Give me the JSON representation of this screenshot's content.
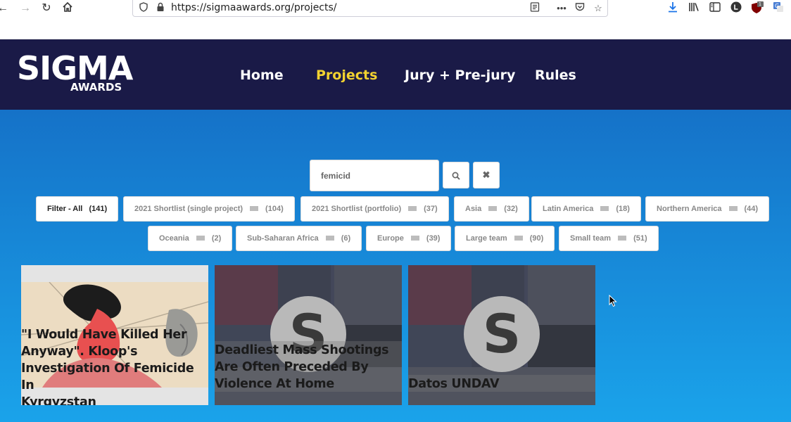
{
  "browser": {
    "url": "https://sigmaawards.org/projects/",
    "badge_count": "1"
  },
  "site": {
    "logo_main": "SIGMA",
    "logo_sub": "AWARDS",
    "nav": [
      {
        "label": "Home"
      },
      {
        "label": "Projects",
        "active": true
      },
      {
        "label": "Jury + Pre-jury"
      },
      {
        "label": "Rules"
      }
    ]
  },
  "search": {
    "value": "femicid",
    "search_icon": "search-icon",
    "clear_icon": "close-icon"
  },
  "filters": [
    {
      "label": "Filter - All",
      "count": "(141)"
    },
    {
      "label": "2021 Shortlist (single project)",
      "count": "(104)"
    },
    {
      "label": "2021 Shortlist (portfolio)",
      "count": "(37)"
    },
    {
      "label": "Asia",
      "count": "(32)"
    },
    {
      "label": "Latin America",
      "count": "(18)"
    },
    {
      "label": "Northern America",
      "count": "(44)"
    },
    {
      "label": "Oceania",
      "count": "(2)"
    },
    {
      "label": "Sub-Saharan Africa",
      "count": "(6)"
    },
    {
      "label": "Europe",
      "count": "(39)"
    },
    {
      "label": "Large team",
      "count": "(90)"
    },
    {
      "label": "Small team",
      "count": "(51)"
    }
  ],
  "projects": [
    {
      "title_lines": [
        "\"I Would Have Killed Her",
        "Anyway\". Kloop's",
        "Investigation Of Femicide In",
        "Kyrgyzstan"
      ]
    },
    {
      "title_lines": [
        "Deadliest Mass Shootings",
        "Are Often Preceded By",
        "Violence At Home"
      ],
      "placeholder_letter": "S"
    },
    {
      "title_lines": [
        "Datos UNDAV"
      ],
      "placeholder_letter": "S"
    }
  ]
}
